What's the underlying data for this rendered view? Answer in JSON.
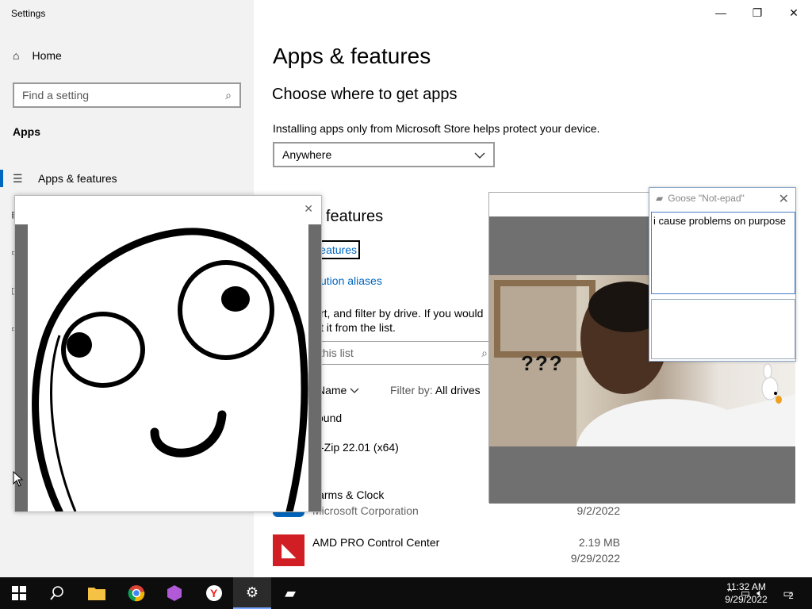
{
  "window": {
    "title": "Settings"
  },
  "sidebar": {
    "home_label": "Home",
    "search_placeholder": "Find a setting",
    "section_label": "Apps",
    "active_item": "Apps & features"
  },
  "main": {
    "title": "Apps & features",
    "choose_heading": "Choose where to get apps",
    "store_description": "Installing apps only from Microsoft Store helps protect your device.",
    "source_dropdown_value": "Anywhere",
    "apps_heading_partial": "& features",
    "optional_features_partial": "features",
    "aliases_partial": "ution aliases",
    "search_description_line1": "rt, and filter by drive. If you would",
    "search_description_line2": "t it from the list.",
    "list_search_placeholder": "this list",
    "sort_label": "Name",
    "filter_label": "Filter by:",
    "filter_value": "All drives",
    "found_label": "ound",
    "apps": [
      {
        "name": "-Zip 22.01 (x64)",
        "publisher": "",
        "size": "",
        "date": ""
      },
      {
        "name": "larms & Clock",
        "publisher": "Microsoft Corporation",
        "size": "",
        "date": "9/2/2022"
      },
      {
        "name": "AMD PRO Control Center",
        "publisher": "",
        "size": "2.19 MB",
        "date": "9/29/2022"
      }
    ]
  },
  "video_popup": {
    "caption": "???"
  },
  "notepad": {
    "title": "Goose \"Not-epad\"",
    "text": "i cause problems on purpose"
  },
  "taskbar": {
    "apps": [
      "start",
      "search",
      "file-explorer",
      "chrome",
      "shapes-app",
      "yandex",
      "settings",
      "not-epad"
    ],
    "time": "11:32 AM",
    "date": "9/29/2022",
    "notification_count": "2"
  },
  "colors": {
    "accent": "#0067c0",
    "taskbar": "#0d0d0d",
    "amd_red": "#d11e25"
  }
}
